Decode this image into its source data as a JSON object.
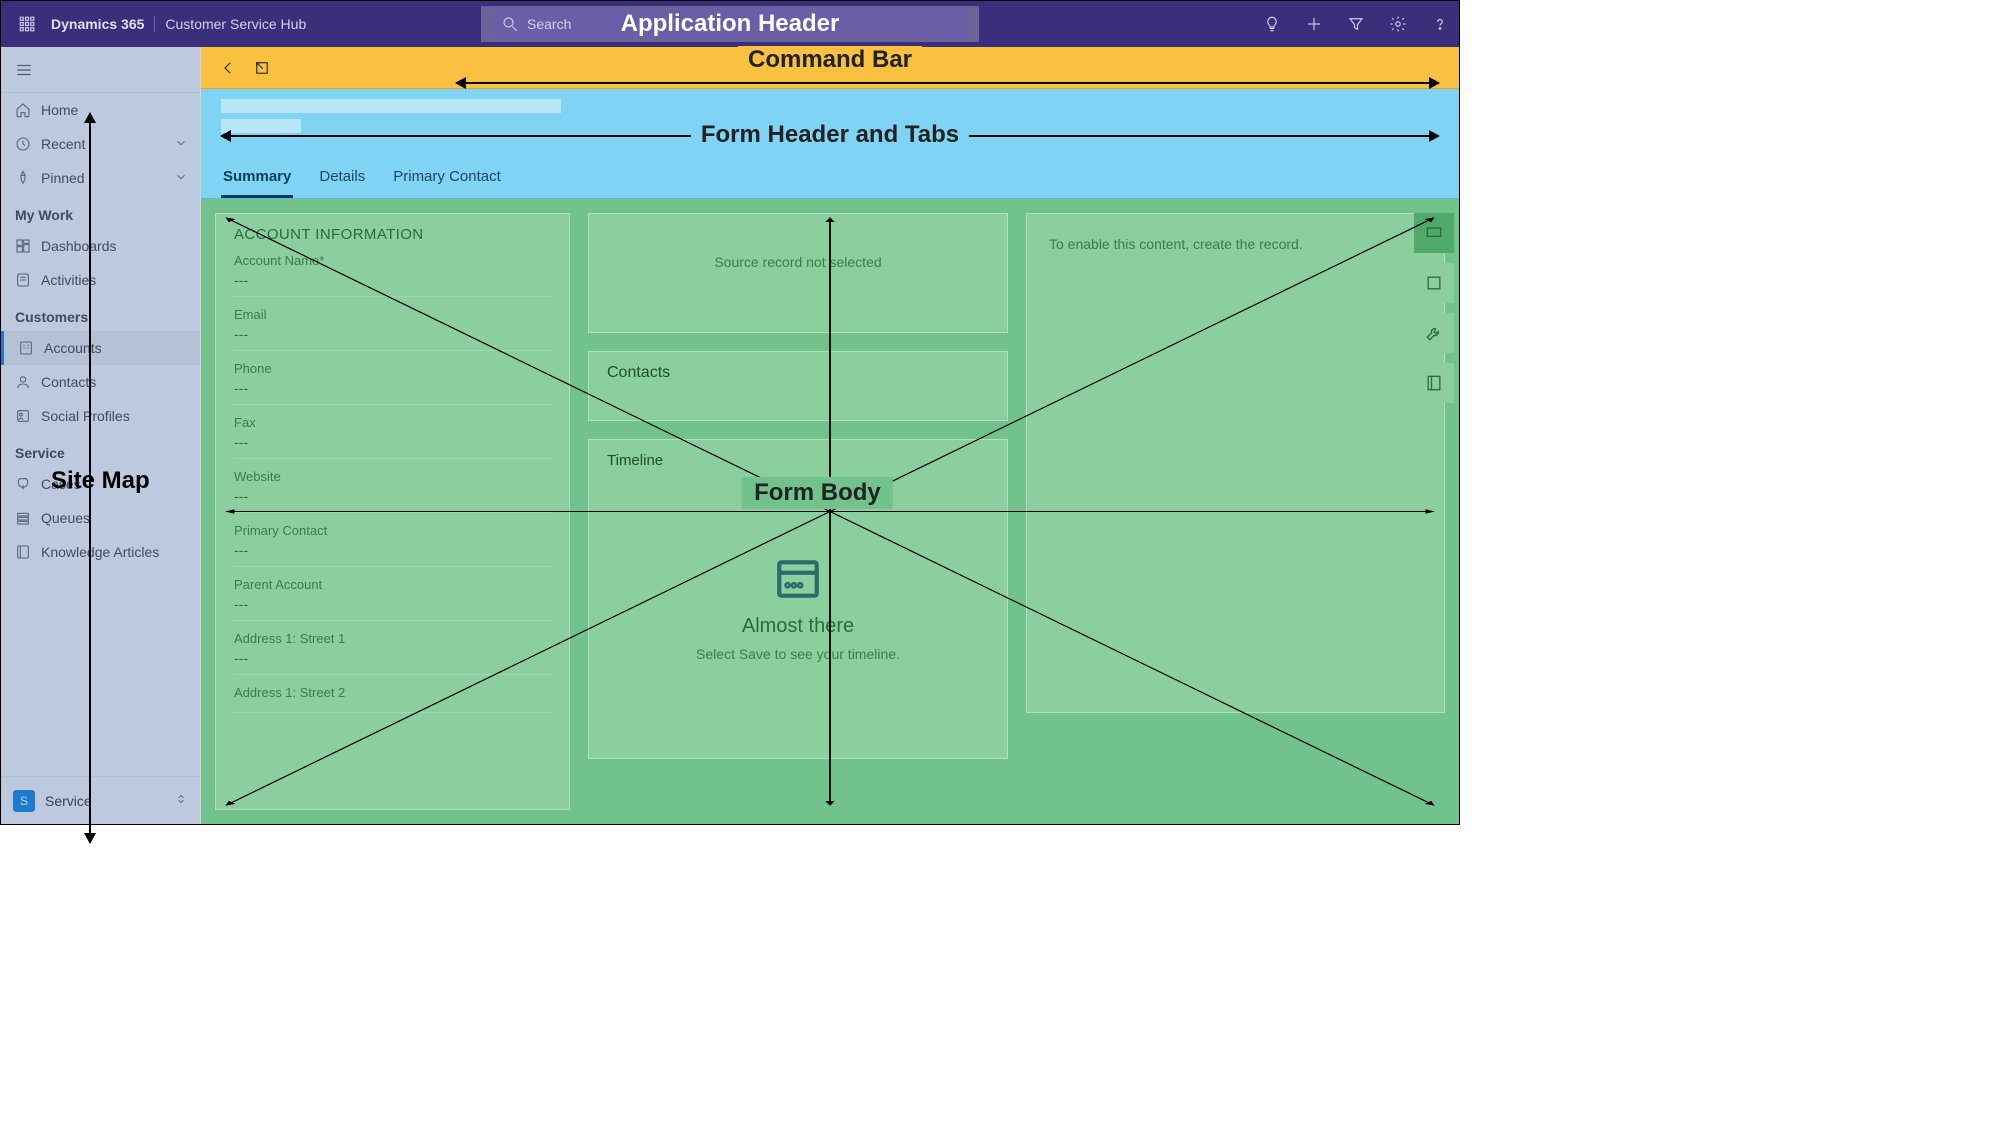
{
  "header": {
    "brand": "Dynamics 365",
    "app_name": "Customer Service Hub",
    "search_placeholder": "Search",
    "annotation": "Application Header"
  },
  "sitemap": {
    "annotation": "Site Map",
    "top": [
      {
        "icon": "home",
        "label": "Home"
      },
      {
        "icon": "clock",
        "label": "Recent",
        "expandable": true
      },
      {
        "icon": "pin",
        "label": "Pinned",
        "expandable": true
      }
    ],
    "groups": [
      {
        "title": "My Work",
        "items": [
          {
            "icon": "dashboard",
            "label": "Dashboards"
          },
          {
            "icon": "activity",
            "label": "Activities"
          }
        ]
      },
      {
        "title": "Customers",
        "items": [
          {
            "icon": "account",
            "label": "Accounts",
            "selected": true
          },
          {
            "icon": "contact",
            "label": "Contacts"
          },
          {
            "icon": "social",
            "label": "Social Profiles"
          }
        ]
      },
      {
        "title": "Service",
        "items": [
          {
            "icon": "case",
            "label": "Cases"
          },
          {
            "icon": "queue",
            "label": "Queues"
          },
          {
            "icon": "kb",
            "label": "Knowledge Articles"
          }
        ]
      }
    ],
    "area": {
      "badge": "S",
      "label": "Service"
    }
  },
  "command_bar": {
    "annotation": "Command Bar"
  },
  "form_header": {
    "annotation": "Form Header and Tabs",
    "tabs": [
      "Summary",
      "Details",
      "Primary Contact"
    ],
    "active_tab": 0
  },
  "form_body": {
    "annotation": "Form Body",
    "account_info": {
      "title": "ACCOUNT INFORMATION",
      "fields": [
        {
          "label": "Account Name*",
          "value": "---"
        },
        {
          "label": "Email",
          "value": "---"
        },
        {
          "label": "Phone",
          "value": "---"
        },
        {
          "label": "Fax",
          "value": "---"
        },
        {
          "label": "Website",
          "value": "---"
        },
        {
          "label": "Primary Contact",
          "value": "---"
        },
        {
          "label": "Parent Account",
          "value": "---"
        },
        {
          "label": "Address 1: Street 1",
          "value": "---"
        },
        {
          "label": "Address 1: Street 2",
          "value": ""
        }
      ]
    },
    "source_msg": "Source record not selected",
    "contacts_title": "Contacts",
    "timeline": {
      "title": "Timeline",
      "empty_title": "Almost there",
      "empty_sub": "Select Save to see your timeline."
    },
    "enable_msg": "To enable this content, create the record."
  }
}
